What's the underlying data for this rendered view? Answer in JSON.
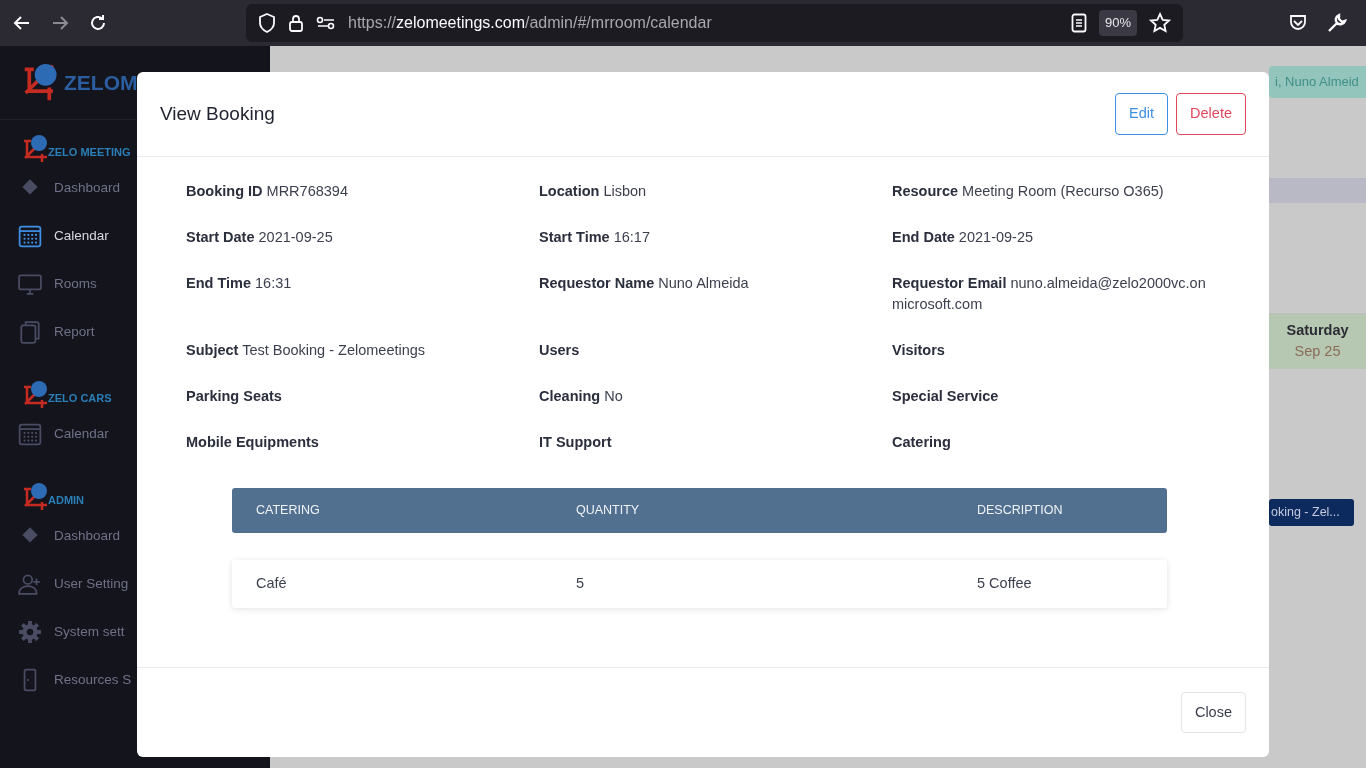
{
  "browser": {
    "url_scheme": "https://",
    "url_host": "zelomeetings.com",
    "url_path": "/admin/#/mrroom/calendar",
    "zoom": "90%"
  },
  "sidebar": {
    "logo_text": "ZELOM",
    "sections": [
      {
        "title": "ZELO MEETING",
        "items": [
          {
            "label": "Dashboard",
            "kind": "layers",
            "selected": false
          },
          {
            "label": "Calendar",
            "kind": "calendar",
            "selected": true
          },
          {
            "label": "Rooms",
            "kind": "monitor",
            "selected": false
          },
          {
            "label": "Report",
            "kind": "pages",
            "selected": false
          }
        ]
      },
      {
        "title": "ZELO CARS",
        "items": [
          {
            "label": "Calendar",
            "kind": "calendar",
            "selected": false
          }
        ]
      },
      {
        "title": "ADMIN",
        "items": [
          {
            "label": "Dashboard",
            "kind": "layers",
            "selected": false
          },
          {
            "label": "User Setting",
            "kind": "user",
            "selected": false
          },
          {
            "label": "System sett",
            "kind": "gear",
            "selected": false
          },
          {
            "label": "Resources S",
            "kind": "door",
            "selected": false
          }
        ]
      }
    ]
  },
  "header": {
    "user_greeting": "i,  Nuno Almeid"
  },
  "calendar": {
    "day": "Saturday",
    "date": "Sep 25",
    "event": "oking - Zel..."
  },
  "modal": {
    "title": "View Booking",
    "actions": [
      {
        "label": "Edit",
        "kind": "primary"
      },
      {
        "label": "Delete",
        "kind": "danger"
      }
    ],
    "fields": [
      {
        "label": "Booking ID",
        "value": "MRR768394"
      },
      {
        "label": "Location",
        "value": "Lisbon"
      },
      {
        "label": "Resource",
        "value": "Meeting Room (Recurso O365)"
      },
      {
        "label": "Start Date",
        "value": "2021-09-25"
      },
      {
        "label": "Start Time",
        "value": "16:17"
      },
      {
        "label": "End Date",
        "value": "2021-09-25"
      },
      {
        "label": "End Time",
        "value": "16:31"
      },
      {
        "label": "Requestor Name",
        "value": "Nuno Almeida"
      },
      {
        "label": "Requestor Email",
        "value": "nuno.almeida@zelo2000vc.onmicrosoft.com"
      },
      {
        "label": "Subject",
        "value": "Test Booking - Zelomeetings"
      },
      {
        "label": "Users"
      },
      {
        "label": "Visitors"
      },
      {
        "label": "Parking Seats"
      },
      {
        "label": "Cleaning",
        "value": "No"
      },
      {
        "label": "Special Service"
      },
      {
        "label": "Mobile Equipments"
      },
      {
        "label": "IT Support"
      },
      {
        "label": "Catering"
      }
    ],
    "catering_table": {
      "columns": [
        "CATERING",
        "QUANTITY",
        "DESCRIPTION"
      ],
      "rows": [
        [
          "Café",
          "5",
          "5 Coffee"
        ]
      ]
    },
    "close": "Close"
  }
}
